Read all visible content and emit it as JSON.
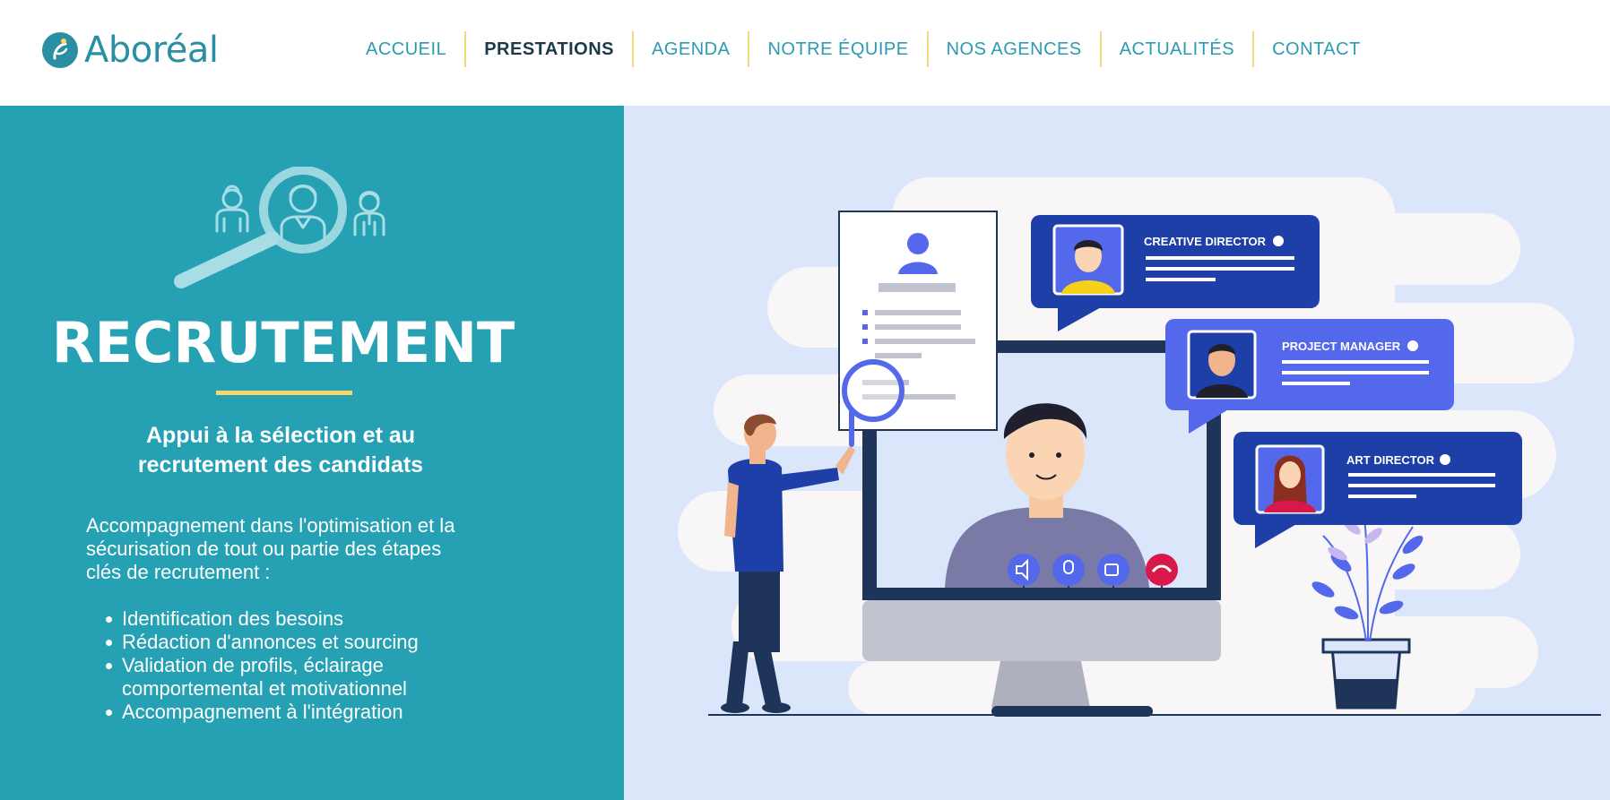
{
  "brand": {
    "name": "Aboréal",
    "primary_color": "#25a1b3",
    "accent_color": "#f6d769",
    "nav_color": "#2a9cb0",
    "nav_active_color": "#1b3b4a",
    "icon": "aboreal-logo-icon"
  },
  "nav": {
    "items": [
      {
        "label": "ACCUEIL",
        "active": false
      },
      {
        "label": "PRESTATIONS",
        "active": true
      },
      {
        "label": "AGENDA",
        "active": false
      },
      {
        "label": "NOTRE ÉQUIPE",
        "active": false
      },
      {
        "label": "NOS AGENCES",
        "active": false
      },
      {
        "label": "ACTUALITÉS",
        "active": false
      },
      {
        "label": "CONTACT",
        "active": false
      }
    ]
  },
  "hero": {
    "icon": "recruitment-search-icon",
    "title": "RECRUTEMENT",
    "subtitle_line1": "Appui à la sélection et au",
    "subtitle_line2": "recrutement des candidats",
    "description_line1": "Accompagnement dans l'optimisation et la",
    "description_line2": "sécurisation de tout ou partie des étapes",
    "description_line3": "clés de recrutement :",
    "bullets": [
      {
        "line1": "Identification des besoins",
        "line2": ""
      },
      {
        "line1": "Rédaction d'annonces et sourcing",
        "line2": ""
      },
      {
        "line1": "Validation de profils, éclairage",
        "line2": "comportemental et motivationnel"
      },
      {
        "line1": "Accompagnement à l'intégration",
        "line2": ""
      }
    ]
  },
  "illustration": {
    "cards": [
      {
        "label": "CREATIVE DIRECTOR",
        "color": "#1f3fa8"
      },
      {
        "label": "PROJECT MANAGER",
        "color": "#5468ec"
      },
      {
        "label": "ART DIRECTOR",
        "color": "#1f3fa8"
      }
    ],
    "call_controls": [
      "speaker-icon",
      "microphone-icon",
      "camera-icon",
      "hang-up-icon"
    ]
  }
}
